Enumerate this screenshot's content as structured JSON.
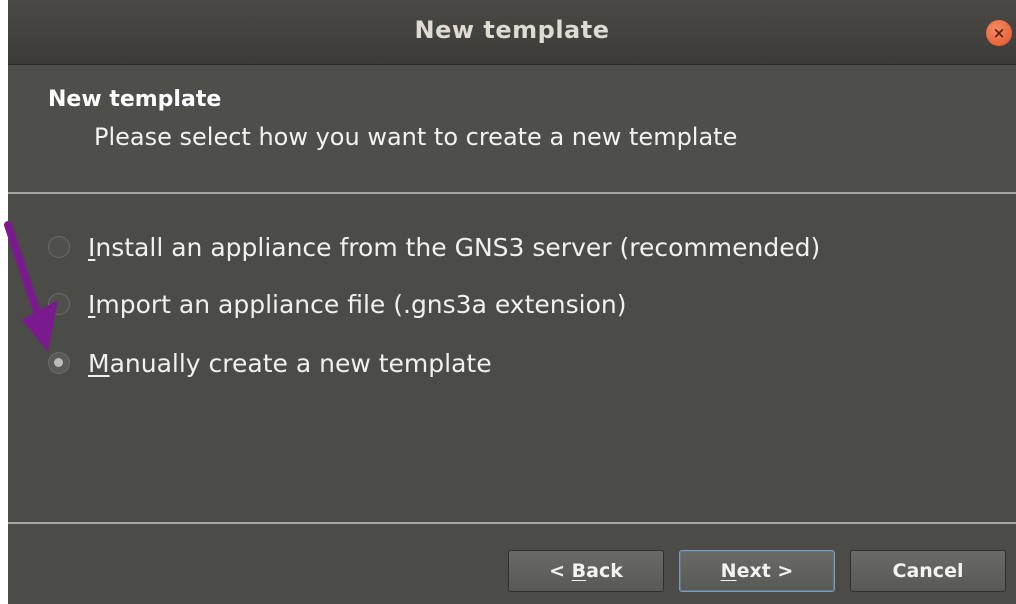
{
  "window": {
    "title": "New template",
    "close_glyph": "×"
  },
  "header": {
    "title": "New template",
    "subtitle": "Please select how you want to create a new template"
  },
  "options": [
    {
      "mnemonic": "I",
      "rest": "nstall an appliance from the GNS3 server (recommended)",
      "selected": false
    },
    {
      "mnemonic": "I",
      "rest": "mport an appliance file (.gns3a extension)",
      "selected": false
    },
    {
      "mnemonic": "M",
      "rest": "anually create a new template",
      "selected": true
    }
  ],
  "buttons": {
    "back": {
      "prefix": "< ",
      "mnemonic": "B",
      "rest": "ack"
    },
    "next": {
      "mnemonic": "N",
      "rest": "ext >"
    },
    "cancel": {
      "label": "Cancel"
    }
  },
  "annotation": {
    "arrow_color": "#7b1a8e",
    "points_to": "Manually create a new template"
  },
  "colors": {
    "window_bg": "#4b4b48",
    "titlebar": "#3c3b37",
    "close_button": "#e3542a",
    "separator": "#a6a6a2"
  }
}
